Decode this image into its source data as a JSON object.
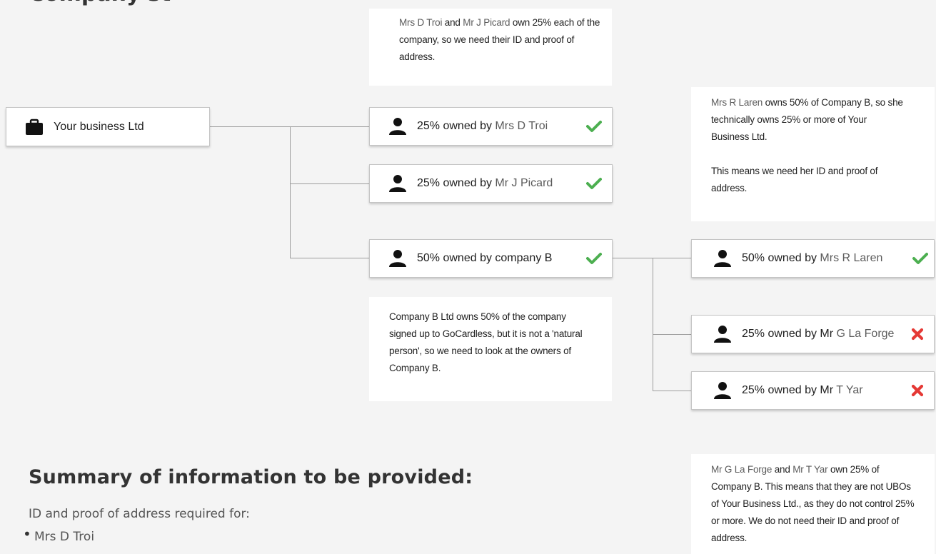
{
  "heading": "Company st",
  "notes": {
    "top": {
      "part1": "Mrs D Troi",
      "part2": " and ",
      "part3": "Mr J Picard",
      "part4": " own 25% each of the company, so we need their ID and proof of address."
    },
    "laren": {
      "part1": "Mrs R Laren",
      "part2": " owns 50% of Company B, so she technically owns 25% or more of Your Business Ltd.",
      "part3": "This means we need her ID and proof of address."
    },
    "companyb": {
      "text": "Company B Ltd owns 50% of the company signed up to GoCardless, but it is not a 'natural person', so we need to look at the owners of Company B."
    },
    "bottom": {
      "part1": "Mr G La Forge",
      "part2": " and ",
      "part3": "Mr T Yar",
      "part4": " own 25% of Company B. This means that they are not UBOs of Your Business Ltd., as they do not control 25% or more. We do not need their ID and proof of address."
    }
  },
  "nodes": {
    "business": {
      "label": "Your business Ltd"
    },
    "troi": {
      "prefix": "25% owned by ",
      "name": "Mrs D Troi",
      "status": "check"
    },
    "picard": {
      "prefix": "25% owned by ",
      "name": "Mr J Picard",
      "status": "check"
    },
    "companyb": {
      "prefix": "50% owned by company B",
      "name": "",
      "status": "check"
    },
    "laren": {
      "prefix": "50% owned by ",
      "name": "Mrs R Laren",
      "status": "check"
    },
    "laforge": {
      "prefix": "25% owned by Mr ",
      "name": "G La Forge",
      "status": "cross"
    },
    "yar": {
      "prefix": "25% owned by Mr ",
      "name": "T Yar",
      "status": "cross"
    }
  },
  "summary": {
    "title": "Summary of information to be provided:",
    "subtitle": "ID and proof of address required for:",
    "items": [
      "Mrs D Troi"
    ]
  },
  "colors": {
    "check": "#4caf50",
    "cross": "#e53935",
    "line": "#9e9e9e"
  }
}
